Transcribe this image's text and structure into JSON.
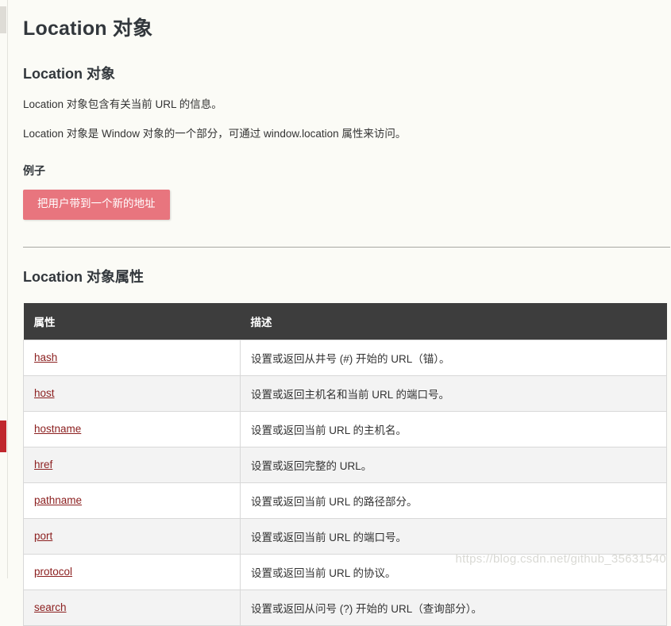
{
  "page": {
    "title": "Location 对象",
    "watermark": "https://blog.csdn.net/github_35631540"
  },
  "intro": {
    "heading": "Location 对象",
    "paragraph_1": "Location 对象包含有关当前 URL 的信息。",
    "paragraph_2": "Location 对象是 Window 对象的一个部分，可通过 window.location 属性来访问。"
  },
  "example": {
    "heading": "例子",
    "button_label": "把用户带到一个新的地址",
    "button_color": "#e8757e"
  },
  "properties_section": {
    "heading": "Location 对象属性",
    "header_bg": "#3d3d3d",
    "link_color": "#8c2020",
    "columns": [
      "属性",
      "描述"
    ],
    "rows": [
      {
        "name": "hash",
        "desc": "设置或返回从井号 (#) 开始的 URL（锚）。"
      },
      {
        "name": "host",
        "desc": "设置或返回主机名和当前 URL 的端口号。"
      },
      {
        "name": "hostname",
        "desc": "设置或返回当前 URL 的主机名。"
      },
      {
        "name": "href",
        "desc": "设置或返回完整的 URL。"
      },
      {
        "name": "pathname",
        "desc": "设置或返回当前 URL 的路径部分。"
      },
      {
        "name": "port",
        "desc": "设置或返回当前 URL 的端口号。"
      },
      {
        "name": "protocol",
        "desc": "设置或返回当前 URL 的协议。"
      },
      {
        "name": "search",
        "desc": "设置或返回从问号 (?) 开始的 URL（查询部分）。"
      }
    ]
  }
}
